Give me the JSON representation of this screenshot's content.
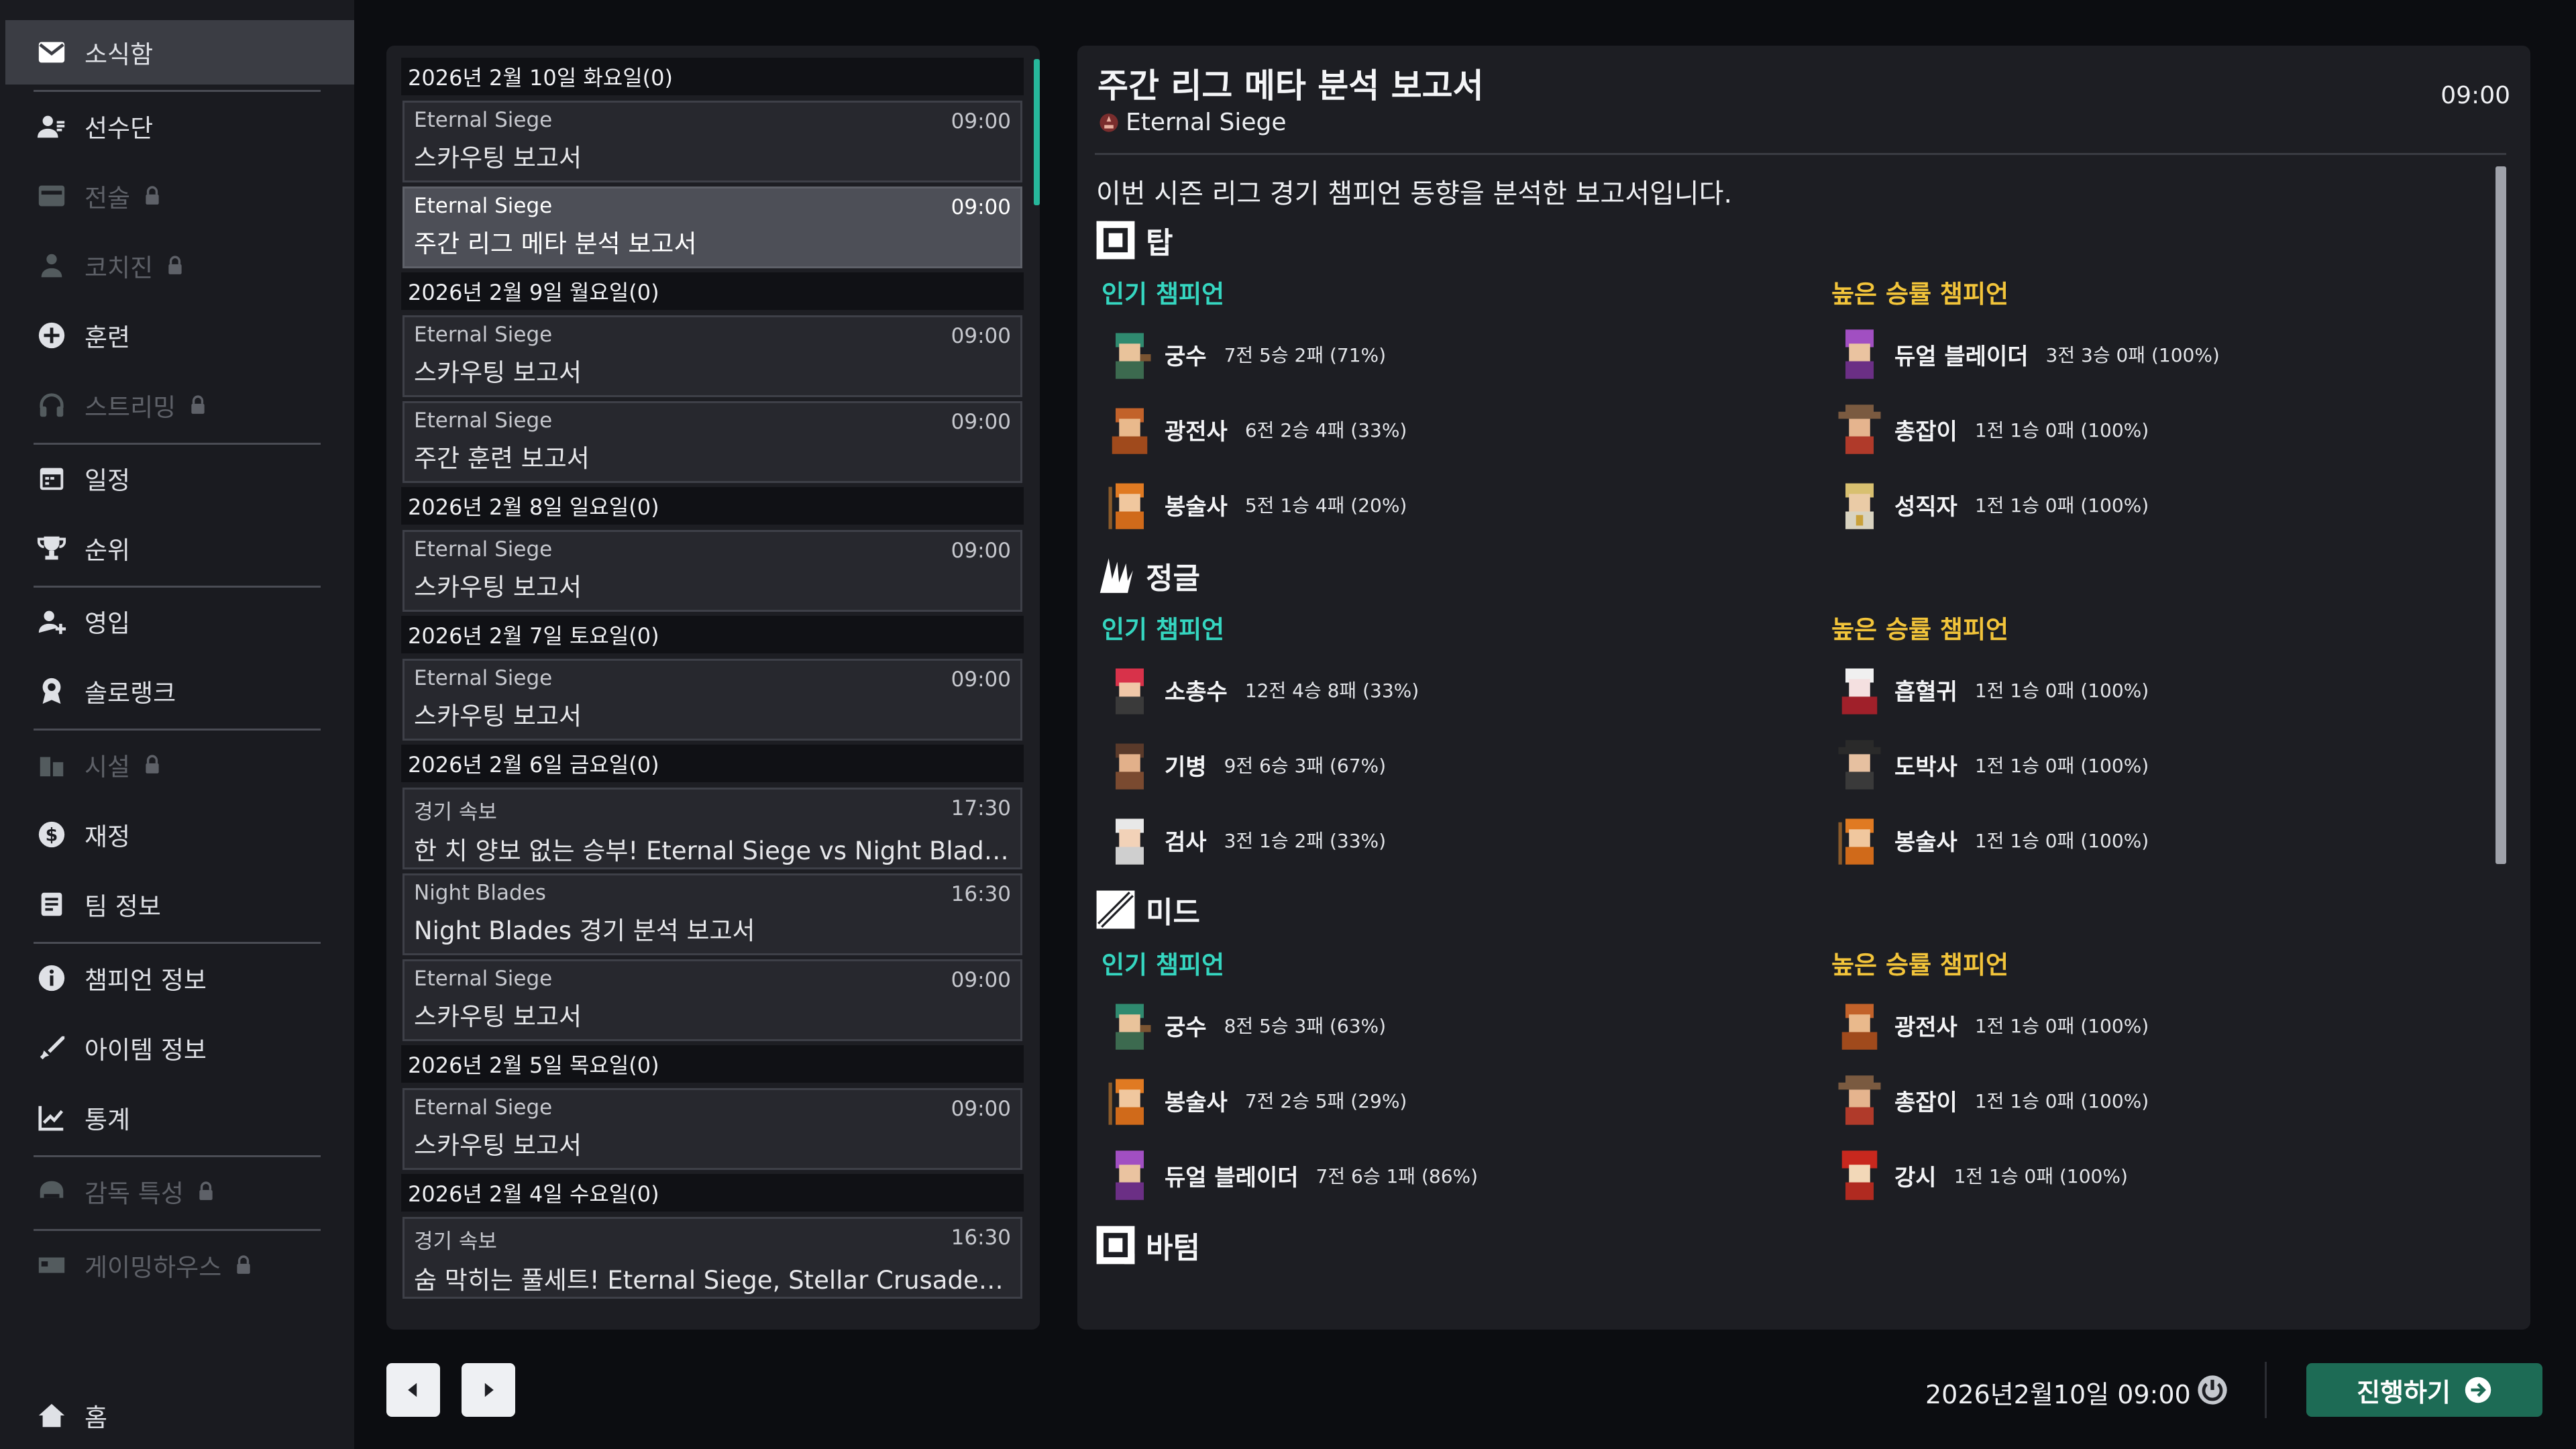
{
  "sidebar": {
    "items": [
      {
        "label": "소식함",
        "icon": "mail-icon",
        "active": true,
        "locked": false
      },
      {
        "label": "선수단",
        "icon": "roster-icon",
        "active": false,
        "locked": false
      },
      {
        "label": "전술",
        "icon": "tactics-icon",
        "active": false,
        "locked": true
      },
      {
        "label": "코치진",
        "icon": "coach-icon",
        "active": false,
        "locked": true
      },
      {
        "label": "훈련",
        "icon": "training-icon",
        "active": false,
        "locked": false
      },
      {
        "label": "스트리밍",
        "icon": "headset-icon",
        "active": false,
        "locked": true
      },
      {
        "label": "일정",
        "icon": "calendar-icon",
        "active": false,
        "locked": false
      },
      {
        "label": "순위",
        "icon": "trophy-icon",
        "active": false,
        "locked": false
      },
      {
        "label": "영입",
        "icon": "recruit-icon",
        "active": false,
        "locked": false
      },
      {
        "label": "솔로랭크",
        "icon": "solorank-icon",
        "active": false,
        "locked": false
      },
      {
        "label": "시설",
        "icon": "facility-icon",
        "active": false,
        "locked": true
      },
      {
        "label": "재정",
        "icon": "finance-icon",
        "active": false,
        "locked": false
      },
      {
        "label": "팀 정보",
        "icon": "team-info-icon",
        "active": false,
        "locked": false
      },
      {
        "label": "챔피언 정보",
        "icon": "info-icon",
        "active": false,
        "locked": false
      },
      {
        "label": "아이템 정보",
        "icon": "sword-icon",
        "active": false,
        "locked": false
      },
      {
        "label": "통계",
        "icon": "chart-icon",
        "active": false,
        "locked": false
      },
      {
        "label": "감독 특성",
        "icon": "manager-trait-icon",
        "active": false,
        "locked": true
      },
      {
        "label": "게이밍하우스",
        "icon": "gaming-house-icon",
        "active": false,
        "locked": true
      }
    ],
    "home_label": "홈"
  },
  "mail_groups": [
    {
      "date": "2026년 2월 10일 화요일(0)",
      "mails": [
        {
          "sender": "Eternal Siege",
          "time": "09:00",
          "subject": "스카우팅 보고서",
          "selected": false
        },
        {
          "sender": "Eternal Siege",
          "time": "09:00",
          "subject": "주간 리그 메타 분석 보고서",
          "selected": true
        }
      ]
    },
    {
      "date": "2026년 2월 9일 월요일(0)",
      "mails": [
        {
          "sender": "Eternal Siege",
          "time": "09:00",
          "subject": "스카우팅 보고서",
          "selected": false
        },
        {
          "sender": "Eternal Siege",
          "time": "09:00",
          "subject": "주간 훈련 보고서",
          "selected": false
        }
      ]
    },
    {
      "date": "2026년 2월 8일 일요일(0)",
      "mails": [
        {
          "sender": "Eternal Siege",
          "time": "09:00",
          "subject": "스카우팅 보고서",
          "selected": false
        }
      ]
    },
    {
      "date": "2026년 2월 7일 토요일(0)",
      "mails": [
        {
          "sender": "Eternal Siege",
          "time": "09:00",
          "subject": "스카우팅 보고서",
          "selected": false
        }
      ]
    },
    {
      "date": "2026년 2월 6일 금요일(0)",
      "mails": [
        {
          "sender": "경기 속보",
          "time": "17:30",
          "subject": "한 치 양보 없는 승부! Eternal Siege vs Night Blades, 풀...",
          "selected": false
        },
        {
          "sender": "Night Blades",
          "time": "16:30",
          "subject": "Night Blades 경기 분석 보고서",
          "selected": false
        },
        {
          "sender": "Eternal Siege",
          "time": "09:00",
          "subject": "스카우팅 보고서",
          "selected": false
        }
      ]
    },
    {
      "date": "2026년 2월 5일 목요일(0)",
      "mails": [
        {
          "sender": "Eternal Siege",
          "time": "09:00",
          "subject": "스카우팅 보고서",
          "selected": false
        }
      ]
    },
    {
      "date": "2026년 2월 4일 수요일(0)",
      "mails": [
        {
          "sender": "경기 속보",
          "time": "16:30",
          "subject": "숨 막히는 풀세트! Eternal Siege, Stellar Crusaders 팁과...",
          "selected": false
        }
      ]
    }
  ],
  "report": {
    "title": "주간 리그 메타 분석 보고서",
    "time": "09:00",
    "team": "Eternal Siege",
    "intro": "이번 시즌 리그 경기 챔피언 동향을 분석한 보고서입니다.",
    "popular_label": "인기 챔피언",
    "winrate_label": "높은 승률 챔피언",
    "lanes": [
      {
        "name": "탑",
        "icon": "top-lane-icon",
        "popular": [
          {
            "name": "궁수",
            "record": "7전 5승 2패 (71%)"
          },
          {
            "name": "광전사",
            "record": "6전 2승 4패 (33%)"
          },
          {
            "name": "봉술사",
            "record": "5전 1승 4패 (20%)"
          }
        ],
        "winrate": [
          {
            "name": "듀얼 블레이더",
            "record": "3전 3승 0패 (100%)"
          },
          {
            "name": "총잡이",
            "record": "1전 1승 0패 (100%)"
          },
          {
            "name": "성직자",
            "record": "1전 1승 0패 (100%)"
          }
        ]
      },
      {
        "name": "정글",
        "icon": "jungle-icon",
        "popular": [
          {
            "name": "소총수",
            "record": "12전 4승 8패 (33%)"
          },
          {
            "name": "기병",
            "record": "9전 6승 3패 (67%)"
          },
          {
            "name": "검사",
            "record": "3전 1승 2패 (33%)"
          }
        ],
        "winrate": [
          {
            "name": "흡혈귀",
            "record": "1전 1승 0패 (100%)"
          },
          {
            "name": "도박사",
            "record": "1전 1승 0패 (100%)"
          },
          {
            "name": "봉술사",
            "record": "1전 1승 0패 (100%)"
          }
        ]
      },
      {
        "name": "미드",
        "icon": "mid-lane-icon",
        "popular": [
          {
            "name": "궁수",
            "record": "8전 5승 3패 (63%)"
          },
          {
            "name": "봉술사",
            "record": "7전 2승 5패 (29%)"
          },
          {
            "name": "듀얼 블레이더",
            "record": "7전 6승 1패 (86%)"
          }
        ],
        "winrate": [
          {
            "name": "광전사",
            "record": "1전 1승 0패 (100%)"
          },
          {
            "name": "총잡이",
            "record": "1전 1승 0패 (100%)"
          },
          {
            "name": "강시",
            "record": "1전 1승 0패 (100%)"
          }
        ]
      },
      {
        "name": "바텀",
        "icon": "bottom-lane-icon",
        "popular": [],
        "winrate": []
      }
    ]
  },
  "footer": {
    "date": "2026년2월10일 09:00",
    "proceed_label": "진행하기"
  },
  "colors": {
    "accent_teal": "#35d6c0",
    "accent_gold": "#f2c43a",
    "proceed_green": "#1d6b55"
  }
}
